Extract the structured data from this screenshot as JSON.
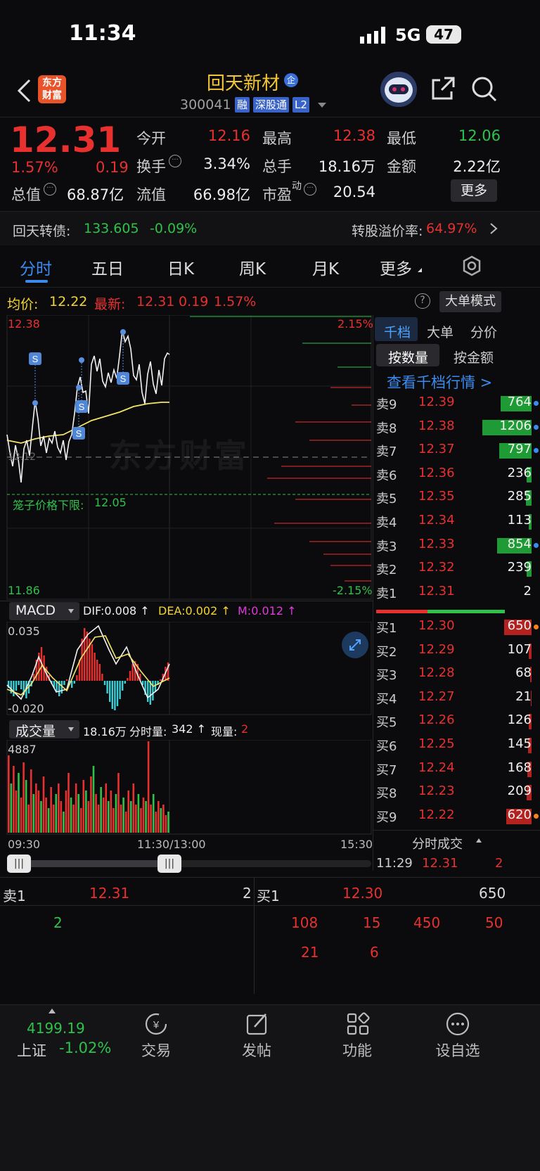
{
  "status": {
    "time": "11:34",
    "network": "5G",
    "battery": "47"
  },
  "header": {
    "logo": "东方\n财富",
    "name": "回天新材",
    "name_badge": "企",
    "code": "300041",
    "tags": [
      "融",
      "深股通",
      "L2"
    ]
  },
  "quote": {
    "price": "12.31",
    "pct": "1.57%",
    "chg": "0.19",
    "rows": [
      [
        {
          "l": "今开",
          "v": "12.16",
          "c": "red"
        },
        {
          "l": "最高",
          "v": "12.38",
          "c": "red"
        },
        {
          "l": "最低",
          "v": "12.06",
          "c": "green"
        }
      ],
      [
        {
          "l": "换手",
          "v": "3.34%",
          "c": "white"
        },
        {
          "l": "总手",
          "v": "18.16万",
          "c": "white"
        },
        {
          "l": "金额",
          "v": "2.22亿",
          "c": "white"
        }
      ],
      [
        {
          "l": "流值",
          "v": "66.98亿",
          "c": "white"
        },
        {
          "l": "市盈",
          "v": "20.54",
          "c": "white"
        }
      ]
    ],
    "total_label": "总值",
    "total_value": "68.87亿",
    "more": "更多",
    "pe_sup": "动"
  },
  "bond": {
    "label": "回天转债:",
    "value": "133.605",
    "chg": "-0.09%",
    "premium_label": "转股溢价率:",
    "premium": "64.97%"
  },
  "tabs": [
    "分时",
    "五日",
    "日K",
    "周K",
    "月K",
    "更多"
  ],
  "avg_line": {
    "avg_label": "均价:",
    "avg": "12.22",
    "latest_label": "最新:",
    "latest": "12.31",
    "chg": "0.19",
    "pct": "1.57%",
    "mode": "大单模式"
  },
  "chart": {
    "high": "12.38",
    "low": "11.86",
    "pct_high": "2.15%",
    "pct_low": "-2.15%",
    "ref": "12.12",
    "cage": "笼子价格下限:",
    "cage_val": "12.05",
    "watermark": "东方财富",
    "times": [
      "09:30",
      "11:30/13:00",
      "15:30"
    ]
  },
  "macd": {
    "label": "MACD",
    "dif": "DIF:0.008 ↑",
    "dea": "DEA:0.002 ↑",
    "m": "M:0.012 ↑",
    "top": "0.035",
    "bot": "-0.020"
  },
  "volume": {
    "label": "成交量",
    "total": "18.16万",
    "tick_label": "分时量:",
    "tick": "342 ↑",
    "now_label": "现量:",
    "now": "2",
    "top": "4887"
  },
  "book": {
    "tabs": [
      "千档",
      "大单",
      "分价"
    ],
    "subtabs": [
      "按数量",
      "按金额"
    ],
    "link": "查看千档行情 >",
    "asks": [
      {
        "l": "卖9",
        "p": "12.39",
        "q": "764",
        "w": 0.63
      },
      {
        "l": "卖8",
        "p": "12.38",
        "q": "1206",
        "w": 1
      },
      {
        "l": "卖7",
        "p": "12.37",
        "q": "797",
        "w": 0.66
      },
      {
        "l": "卖6",
        "p": "12.36",
        "q": "236",
        "w": 0.1
      },
      {
        "l": "卖5",
        "p": "12.35",
        "q": "285",
        "w": 0.12
      },
      {
        "l": "卖4",
        "p": "12.34",
        "q": "113",
        "w": 0.05
      },
      {
        "l": "卖3",
        "p": "12.33",
        "q": "854",
        "w": 0.7
      },
      {
        "l": "卖2",
        "p": "12.32",
        "q": "239",
        "w": 0.1
      },
      {
        "l": "卖1",
        "p": "12.31",
        "q": "2",
        "w": 0
      }
    ],
    "bids": [
      {
        "l": "买1",
        "p": "12.30",
        "q": "650",
        "w": 0.55
      },
      {
        "l": "买2",
        "p": "12.29",
        "q": "107",
        "w": 0.05
      },
      {
        "l": "买3",
        "p": "12.28",
        "q": "68",
        "w": 0.03
      },
      {
        "l": "买4",
        "p": "12.27",
        "q": "21",
        "w": 0.01
      },
      {
        "l": "买5",
        "p": "12.26",
        "q": "126",
        "w": 0.06
      },
      {
        "l": "买6",
        "p": "12.25",
        "q": "145",
        "w": 0.07
      },
      {
        "l": "买7",
        "p": "12.24",
        "q": "168",
        "w": 0.08
      },
      {
        "l": "买8",
        "p": "12.23",
        "q": "209",
        "w": 0.1
      },
      {
        "l": "买9",
        "p": "12.22",
        "q": "620",
        "w": 0.52
      }
    ],
    "trades_label": "分时成交",
    "trade": {
      "t": "11:29",
      "p": "12.31",
      "q": "2"
    }
  },
  "queue": {
    "sell_label": "卖1",
    "sell_price": "12.31",
    "sell_qty": "2",
    "sell_items": [
      "2"
    ],
    "buy_label": "买1",
    "buy_price": "12.30",
    "buy_qty": "650",
    "buy_items": [
      "108",
      "15",
      "450",
      "50",
      "21",
      "6"
    ]
  },
  "bottom": {
    "index_value": "4199.19",
    "index_name": "上证",
    "index_chg": "-1.02%",
    "items": [
      "交易",
      "发帖",
      "功能",
      "设自选"
    ]
  }
}
